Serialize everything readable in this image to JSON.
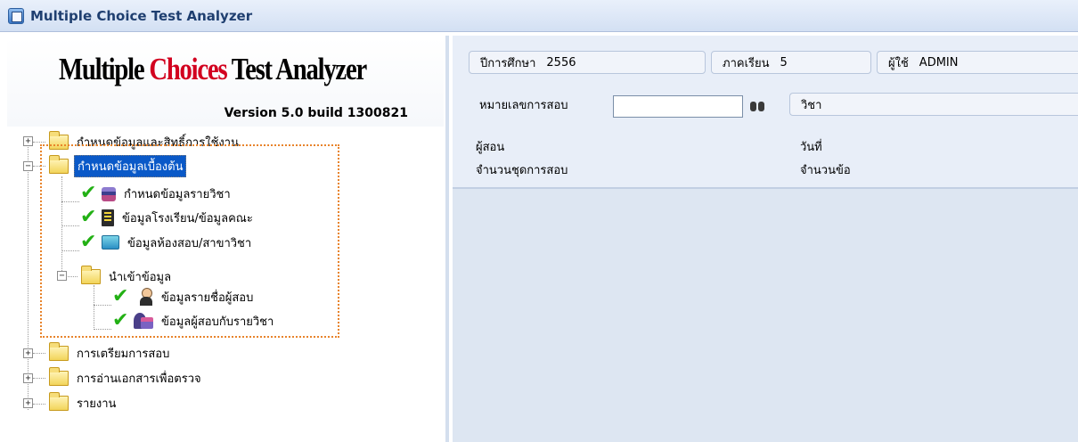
{
  "window": {
    "title": "Multiple Choice Test Analyzer",
    "icon": "app-icon"
  },
  "header": {
    "logo_part1": "Multiple ",
    "logo_accent": "Choices",
    "logo_part2": " Test Analyzer",
    "version": "Version 5.0  build 1300821"
  },
  "tree": {
    "items": [
      {
        "label": "กำหนดข้อมูลและสิทธิ์การใช้งาน",
        "type": "folder",
        "expander": "+"
      },
      {
        "label": "กำหนดข้อมูลเบื้องต้น",
        "type": "folder",
        "expander": "−",
        "selected": true
      },
      {
        "label": "กำหนดข้อมูลรายวิชา",
        "type": "item",
        "icon": "books-icon"
      },
      {
        "label": "ข้อมูลโรงเรียน/ข้อมูลคณะ",
        "type": "item",
        "icon": "document-icon"
      },
      {
        "label": "ข้อมูลห้องสอบ/สาขาวิชา",
        "type": "item",
        "icon": "folder-blue-icon"
      },
      {
        "label": "นำเข้าข้อมูล",
        "type": "folder",
        "expander": "−"
      },
      {
        "label": "ข้อมูลรายชื่อผู้สอบ",
        "type": "item",
        "icon": "person-icon"
      },
      {
        "label": "ข้อมูลผู้สอบกับรายวิชา",
        "type": "item",
        "icon": "person-books-icon"
      },
      {
        "label": "การเตรียมการสอบ",
        "type": "folder",
        "expander": "+"
      },
      {
        "label": "การอ่านเอกสารเพื่อตรวจ",
        "type": "folder",
        "expander": "+"
      },
      {
        "label": "รายงาน",
        "type": "folder",
        "expander": "+"
      }
    ],
    "highlight_color": "#e8842c",
    "check_icon": "check-icon",
    "check_color": "#22b014"
  },
  "info": {
    "year_label": "ปีการศึกษา",
    "year_value": "2556",
    "term_label": "ภาคเรียน",
    "term_value": "5",
    "user_label": "ผู้ใช้",
    "user_value": "ADMIN",
    "exam_no_label": "หมายเลขการสอบ",
    "exam_no_value": "",
    "search_icon": "binoculars-icon",
    "subject_label": "วิชา",
    "teacher_label": "ผู้สอน",
    "date_label": "วันที่",
    "sets_label": "จำนวนชุดการสอบ",
    "questions_label": "จำนวนข้อ"
  },
  "colors": {
    "selection": "#0a59c8",
    "logo_accent": "#d2001f",
    "panel_bg": "#dde6f2"
  }
}
